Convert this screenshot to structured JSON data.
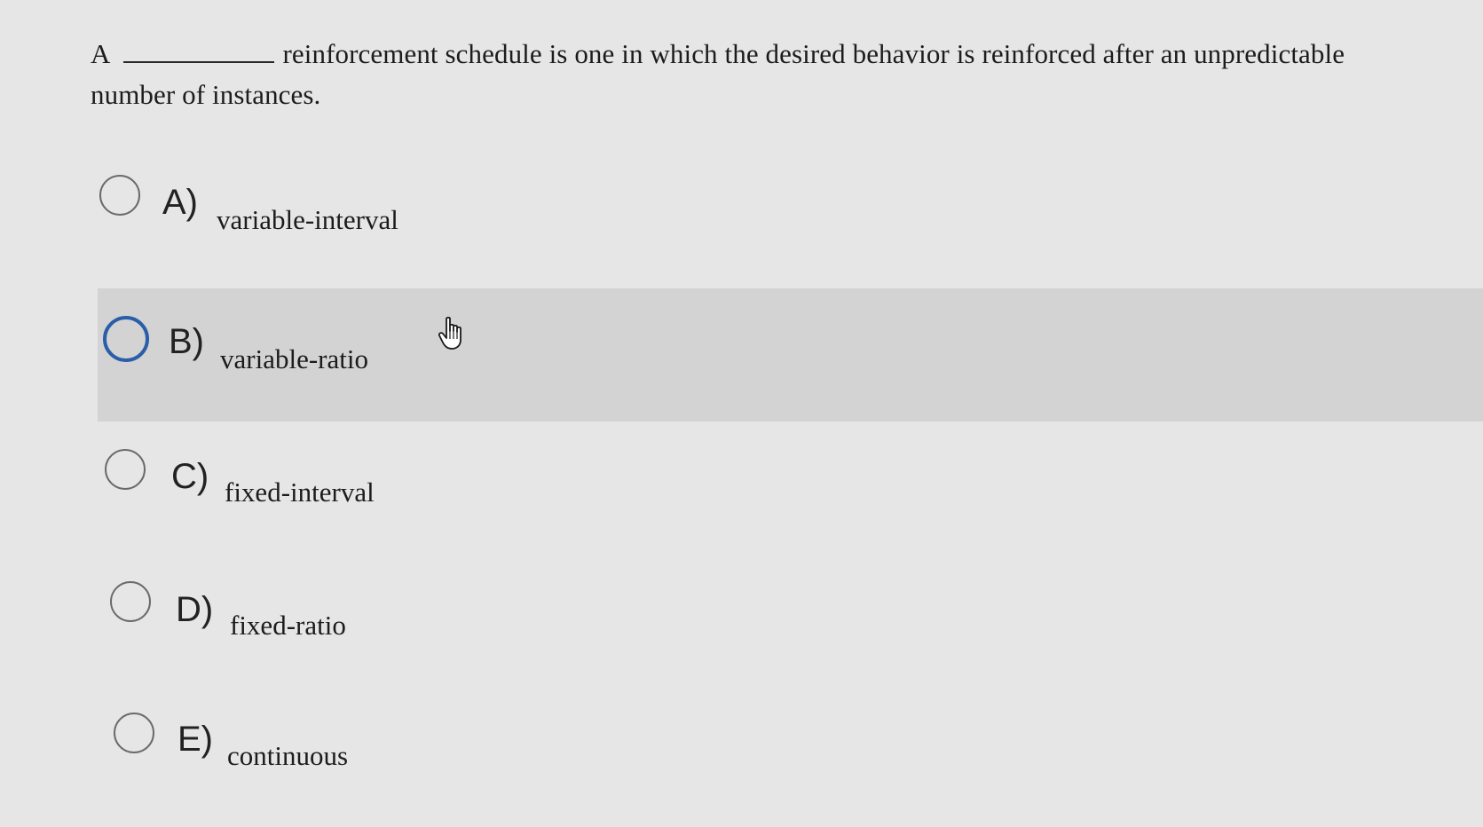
{
  "question": {
    "prefix": "A",
    "line1_rest": "reinforcement schedule is one in which the desired behavior is reinforced after an unpredictable",
    "line2": "number of instances."
  },
  "options": [
    {
      "letter": "A)",
      "text": "variable-interval"
    },
    {
      "letter": "B)",
      "text": "variable-ratio"
    },
    {
      "letter": "C)",
      "text": "fixed-interval"
    },
    {
      "letter": "D)",
      "text": "fixed-ratio"
    },
    {
      "letter": "E)",
      "text": "continuous"
    }
  ],
  "colors": {
    "page_background": "#e6e6e6",
    "hover_row": "#d3d3d3",
    "focus_ring": "#2a5ea8"
  },
  "icons": {
    "cursor": "hand-pointer-icon"
  }
}
